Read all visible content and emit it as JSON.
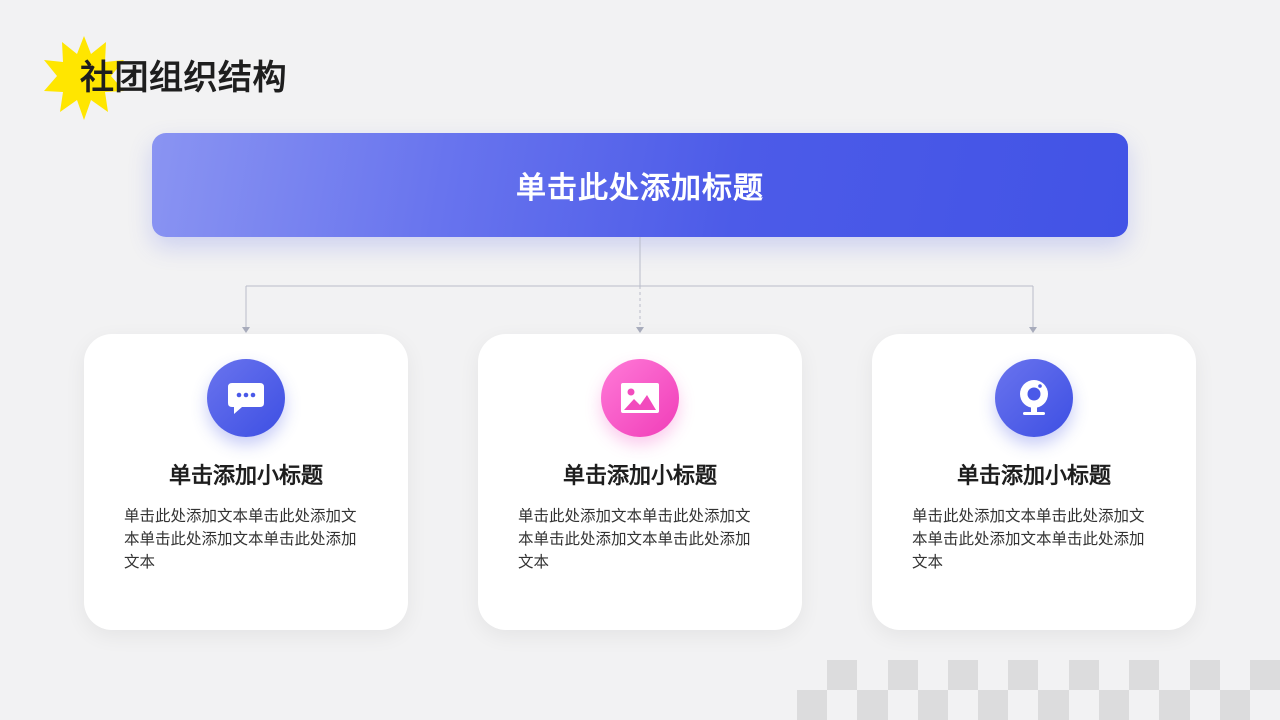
{
  "page": {
    "title": "社团组织结构",
    "accent_color": "#4a59e8",
    "burst_color": "#ffe600"
  },
  "banner": {
    "title": "单击此处添加标题"
  },
  "cards": [
    {
      "icon": "chat-bubble-icon",
      "icon_color": "#4a59e8",
      "title": "单击添加小标题",
      "body": "单击此处添加文本单击此处添加文本单击此处添加文本单击此处添加文本"
    },
    {
      "icon": "image-icon",
      "icon_color": "#f24bbd",
      "title": "单击添加小标题",
      "body": "单击此处添加文本单击此处添加文本单击此处添加文本单击此处添加文本"
    },
    {
      "icon": "webcam-icon",
      "icon_color": "#4a59e8",
      "title": "单击添加小标题",
      "body": "单击此处添加文本单击此处添加文本单击此处添加文本单击此处添加文本"
    }
  ]
}
